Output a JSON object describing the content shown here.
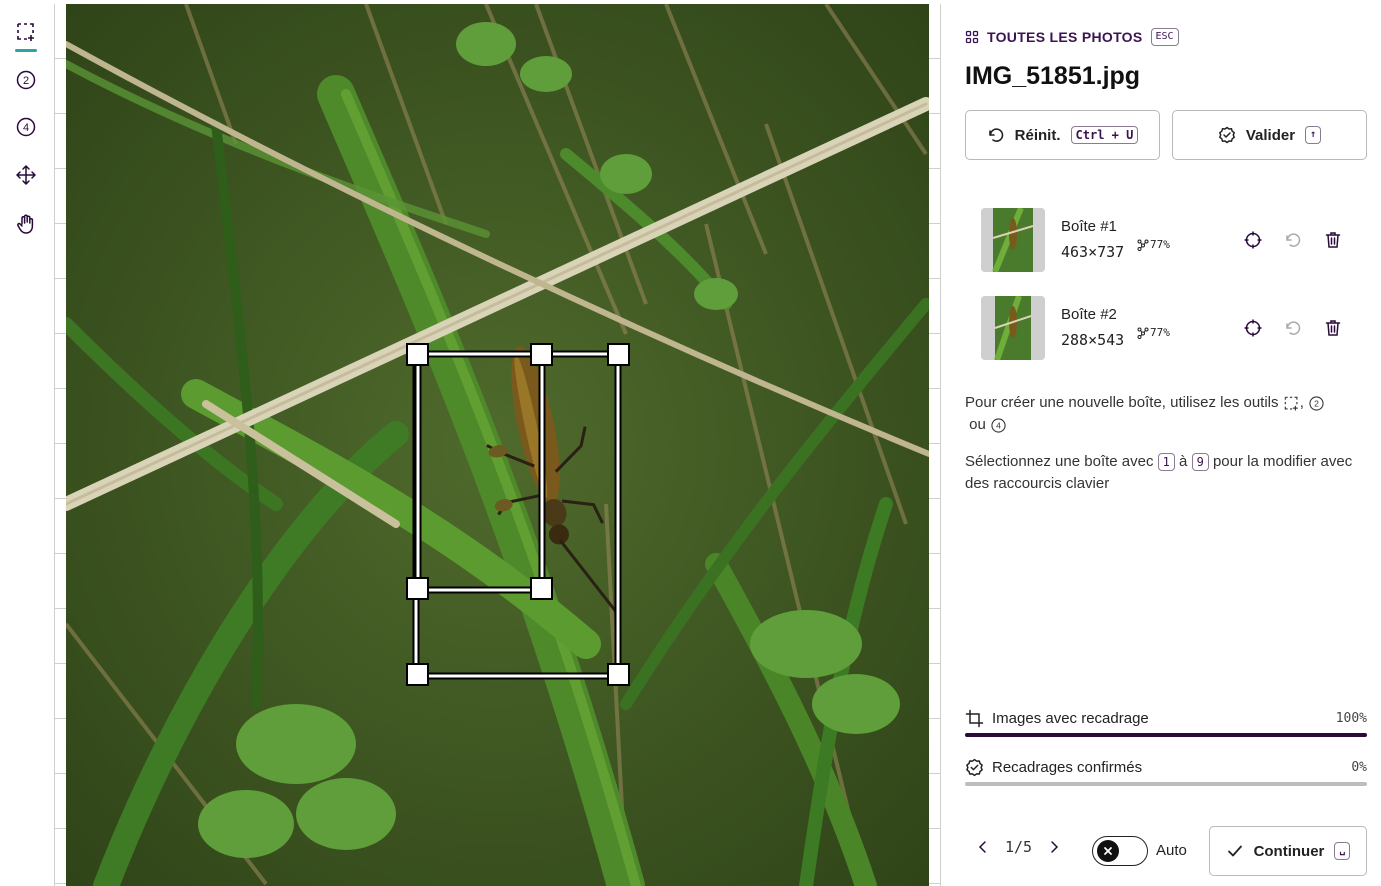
{
  "toolbar": {
    "tools": [
      {
        "name": "rectangle-select-tool",
        "icon": "dashed-rectangle-plus-icon",
        "active": true
      },
      {
        "name": "two-points-tool",
        "icon": "circled-2-icon",
        "label": "2"
      },
      {
        "name": "four-points-tool",
        "icon": "circled-4-icon",
        "label": "4"
      },
      {
        "name": "move-tool",
        "icon": "move-arrows-icon"
      },
      {
        "name": "pan-tool",
        "icon": "hand-icon"
      }
    ]
  },
  "header": {
    "back_label": "TOUTES LES PHOTOS",
    "back_shortcut": "ESC",
    "filename": "IMG_51851.jpg"
  },
  "actions": {
    "reset_label": "Réinit.",
    "reset_shortcut": "Ctrl + U",
    "validate_label": "Valider",
    "validate_shortcut": "↑"
  },
  "boxes": [
    {
      "name": "Boîte #1",
      "dims": "463×737",
      "confidence": "77%"
    },
    {
      "name": "Boîte #2",
      "dims": "288×543",
      "confidence": "77%"
    }
  ],
  "help": {
    "create_text": "Pour créer une nouvelle boîte, utilisez les outils",
    "create_sep": ",",
    "create_or": "ou",
    "create_two": "2",
    "create_four": "4",
    "select_pre": "Sélectionnez une boîte avec",
    "select_key_from": "1",
    "select_mid": "à",
    "select_key_to": "9",
    "select_post": "pour la modifier avec des raccourcis clavier"
  },
  "progress": [
    {
      "label": "Images avec recadrage",
      "value_text": "100%",
      "fraction": 1.0
    },
    {
      "label": "Recadrages confirmés",
      "value_text": "0%",
      "fraction": 0.0
    }
  ],
  "footer": {
    "page": "1/5",
    "auto_label": "Auto",
    "continue_label": "Continuer",
    "continue_shortcut": "␣"
  },
  "colors": {
    "accent": "#2a0a3c",
    "active_tool": "#2fa3a0",
    "primary_text": "#3a1450"
  }
}
